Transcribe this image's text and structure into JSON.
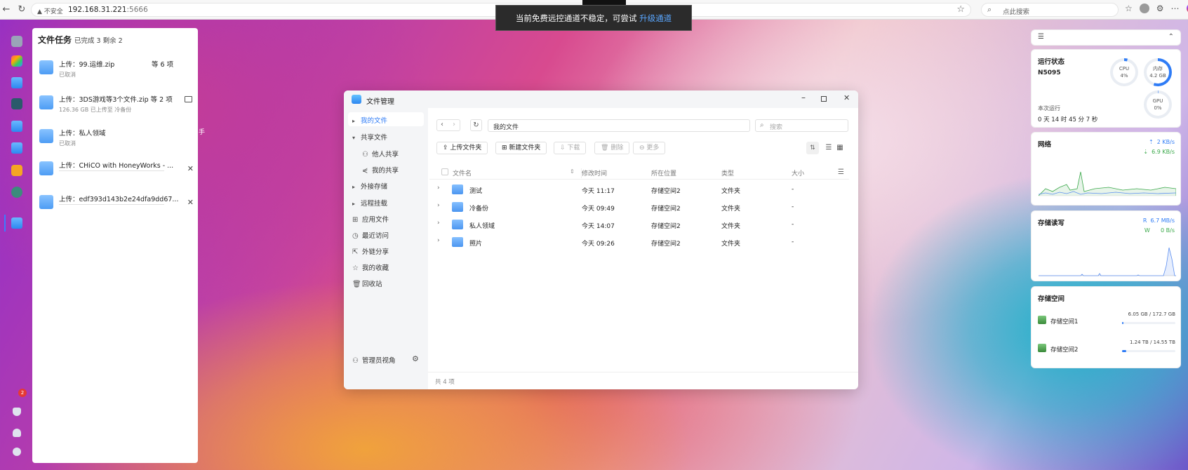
{
  "browser": {
    "security": "不安全",
    "url_host": "192.168.31.221",
    "url_port": ":5666",
    "search_placeholder": "点此搜索"
  },
  "toast": {
    "message": "当前免费远控通道不稳定，可尝试",
    "link": "升级通道"
  },
  "dock": {
    "badge": "2"
  },
  "tasks": {
    "title": "文件任务",
    "summary": "已完成 3 剩余 2",
    "items": [
      {
        "name": "上传：99.运维.zip",
        "extra": "等 6 项",
        "sub": "已取消"
      },
      {
        "name": "上传：3DS游戏等3个文件.zip 等 2 项",
        "sub": "126.36 GB  已上传至 冷备份"
      },
      {
        "name": "上传：私人领域",
        "sub": "已取消"
      },
      {
        "name": "上传：CHiCO with HoneyWorks - ...",
        "sub": ""
      },
      {
        "name": "上传：edf393d143b2e24dfa9dd67...",
        "sub": ""
      }
    ],
    "overflow_text": "手"
  },
  "widgets": {
    "status": {
      "title": "运行状态",
      "device": "N5095",
      "cpu_label": "CPU",
      "cpu_value": "4%",
      "mem_label": "内存",
      "mem_value": "4.2 GB",
      "gpu_label": "GPU",
      "gpu_value": "0%",
      "uptime_label": "本次运行",
      "uptime": "0 天 14 时 45 分 7 秒",
      "cpu_percent": 4,
      "mem_percent": 55,
      "gpu_percent": 0
    },
    "network": {
      "title": "网络",
      "up": "2 KB/s",
      "down": "6.9 KB/s"
    },
    "disk_io": {
      "title": "存储读写",
      "r_label": "R",
      "r": "6.7 MB/s",
      "w_label": "W",
      "w": "0 B/s"
    },
    "storage": {
      "title": "存储空间",
      "vols": [
        {
          "name": "存储空间1",
          "usage": "6.05 GB / 172.7 GB",
          "percent": 3
        },
        {
          "name": "存储空间2",
          "usage": "1.24 TB / 14.55 TB",
          "percent": 8
        }
      ]
    }
  },
  "fm": {
    "title": "文件管理",
    "path": "我的文件",
    "search_placeholder": "搜索",
    "sidebar": [
      {
        "label": "我的文件",
        "active": true
      },
      {
        "label": "共享文件"
      },
      {
        "label": "他人共享"
      },
      {
        "label": "我的共享"
      },
      {
        "label": "外接存储"
      },
      {
        "label": "远程挂载"
      },
      {
        "label": "应用文件"
      },
      {
        "label": "最近访问"
      },
      {
        "label": "外链分享"
      },
      {
        "label": "我的收藏"
      },
      {
        "label": "回收站"
      }
    ],
    "admin_view": "管理员视角",
    "toolbar": {
      "upload": "上传文件夹",
      "new_folder": "新建文件夹",
      "download": "下载",
      "delete": "删除",
      "more": "更多"
    },
    "columns": {
      "name": "文件名",
      "mtime": "修改时间",
      "location": "所在位置",
      "type": "类型",
      "size": "大小"
    },
    "rows": [
      {
        "name": "测试",
        "mtime": "今天 11:17",
        "location": "存储空间2",
        "type": "文件夹",
        "size": "-"
      },
      {
        "name": "冷备份",
        "mtime": "今天 09:49",
        "location": "存储空间2",
        "type": "文件夹",
        "size": "-"
      },
      {
        "name": "私人领域",
        "mtime": "今天 14:07",
        "location": "存储空间2",
        "type": "文件夹",
        "size": "-"
      },
      {
        "name": "照片",
        "mtime": "今天 09:26",
        "location": "存储空间2",
        "type": "文件夹",
        "size": "-"
      }
    ],
    "footer": "共 4 项"
  },
  "colors": {
    "accent": "#2f7cf6",
    "upload_green": "#3aa84a"
  }
}
